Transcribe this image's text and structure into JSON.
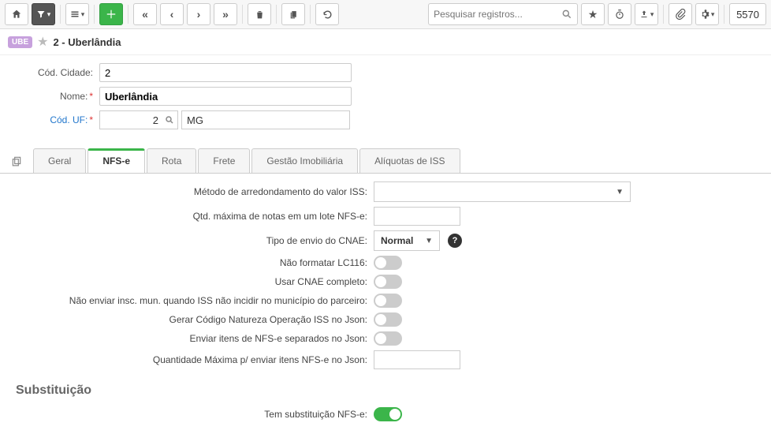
{
  "toolbar": {
    "search_placeholder": "Pesquisar registros...",
    "count": "5570"
  },
  "header": {
    "badge": "UBE",
    "title": "2 - Uberlândia"
  },
  "form": {
    "cod_cidade_label": "Cód. Cidade:",
    "cod_cidade_value": "2",
    "nome_label": "Nome:",
    "nome_value": "Uberlândia",
    "cod_uf_label": "Cód. UF:",
    "cod_uf_value": "2",
    "cod_uf_desc": "MG"
  },
  "tabs": [
    "Geral",
    "NFS-e",
    "Rota",
    "Frete",
    "Gestão Imobiliária",
    "Alíquotas de ISS"
  ],
  "nfse": {
    "metodo_arredondamento_label": "Método de arredondamento do valor ISS:",
    "metodo_arredondamento_value": "",
    "qtd_max_lote_label": "Qtd. máxima de notas em um lote NFS-e:",
    "tipo_envio_cnae_label": "Tipo de envio do CNAE:",
    "tipo_envio_cnae_value": "Normal",
    "nao_formatar_lc116_label": "Não formatar LC116:",
    "usar_cnae_completo_label": "Usar CNAE completo:",
    "nao_enviar_insc_label": "Não enviar insc. mun. quando ISS não incidir no município do parceiro:",
    "gerar_cod_natureza_label": "Gerar Código Natureza Operação ISS no Json:",
    "enviar_itens_separados_label": "Enviar itens de NFS-e separados no Json:",
    "qtd_max_itens_json_label": "Quantidade Máxima p/ enviar itens NFS-e no Json:",
    "substituicao_title": "Substituição",
    "tem_substituicao_label": "Tem substituição NFS-e:"
  }
}
